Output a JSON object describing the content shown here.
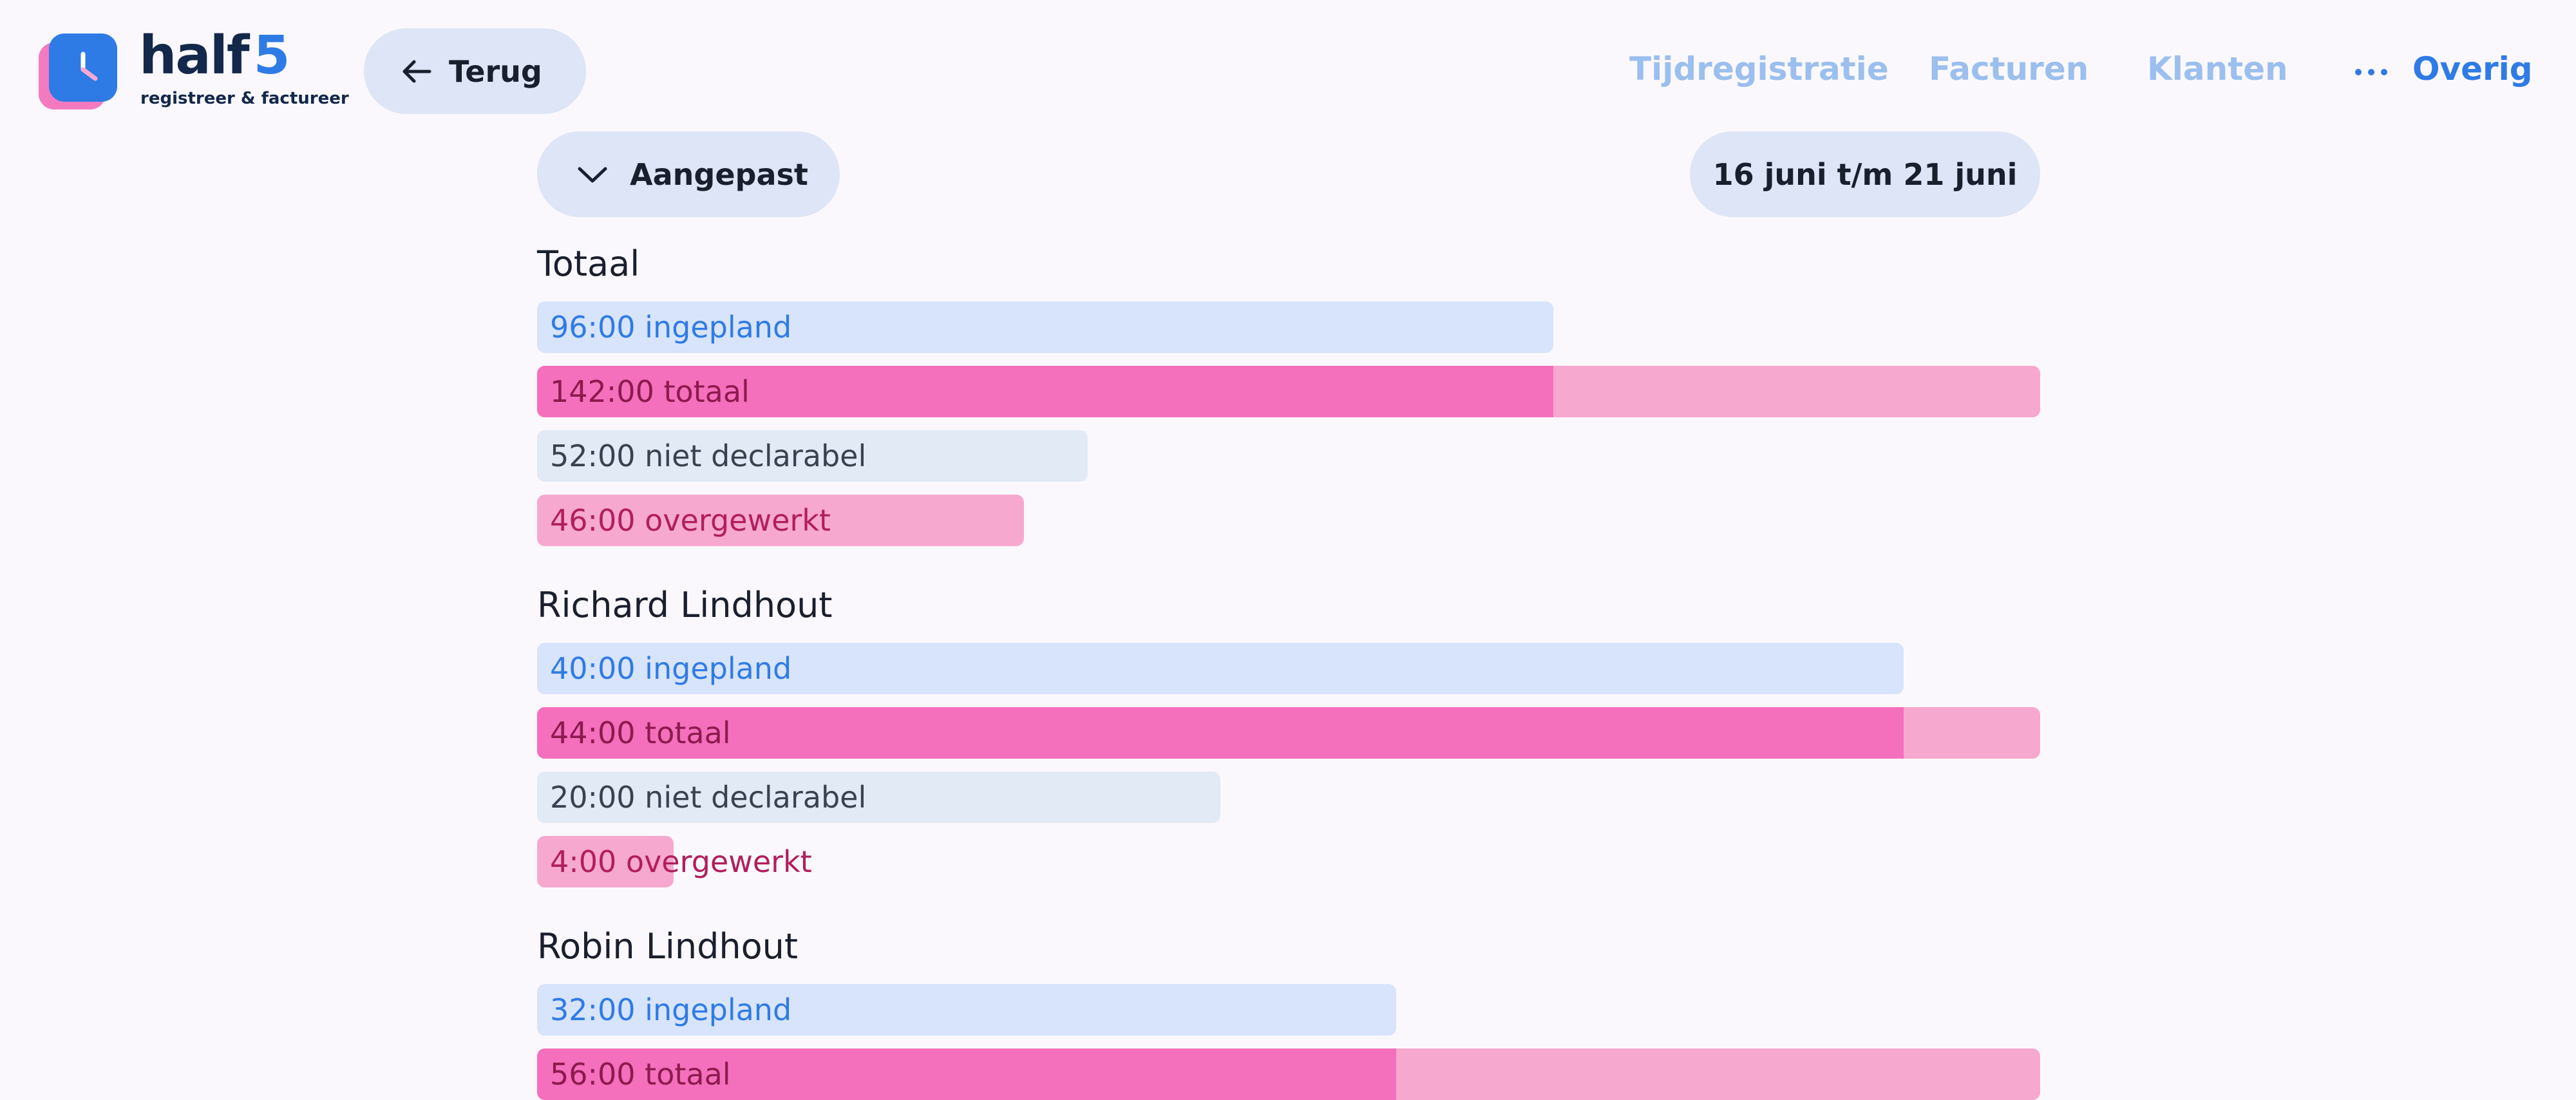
{
  "brand": {
    "name": "half",
    "number": "5",
    "tagline": "registreer & factureer"
  },
  "back_button": {
    "label": "Terug",
    "icon": "arrow-left-icon"
  },
  "nav": {
    "items": [
      {
        "label": "Tijdregistratie"
      },
      {
        "label": "Facturen"
      },
      {
        "label": "Klanten"
      }
    ],
    "more": {
      "label": "Overig",
      "icon": "more-dots-icon"
    }
  },
  "filter": {
    "label": "Aangepast",
    "icon": "chevron-down-icon"
  },
  "period": {
    "label": "16 juni t/m 21 juni"
  },
  "colors": {
    "ingepland_bg": "#d7e4fb",
    "ingepland_text": "#2f7be6",
    "totaal_bar": "#f46fbc",
    "totaal_overflow": "#f7a8cf",
    "niet_declarabel_bg": "#e2eaf5",
    "overgewerkt_bg": "#f7a8cf",
    "accent": "#2f7be6"
  },
  "sections": [
    {
      "title": "Totaal",
      "bars": [
        {
          "type": "ingepland",
          "label": "96:00 ingepland",
          "hours": 96
        },
        {
          "type": "totaal",
          "label": "142:00 totaal",
          "hours": 142
        },
        {
          "type": "niet",
          "label": "52:00 niet declarabel",
          "hours": 52
        },
        {
          "type": "over",
          "label": "46:00 overgewerkt",
          "hours": 46
        }
      ]
    },
    {
      "title": "Richard Lindhout",
      "bars": [
        {
          "type": "ingepland",
          "label": "40:00 ingepland",
          "hours": 40
        },
        {
          "type": "totaal",
          "label": "44:00 totaal",
          "hours": 44
        },
        {
          "type": "niet",
          "label": "20:00 niet declarabel",
          "hours": 20
        },
        {
          "type": "over",
          "label": "4:00 overgewerkt",
          "hours": 4
        }
      ]
    },
    {
      "title": "Robin Lindhout",
      "bars": [
        {
          "type": "ingepland",
          "label": "32:00 ingepland",
          "hours": 32
        },
        {
          "type": "totaal",
          "label": "56:00 totaal",
          "hours": 56
        }
      ]
    }
  ]
}
